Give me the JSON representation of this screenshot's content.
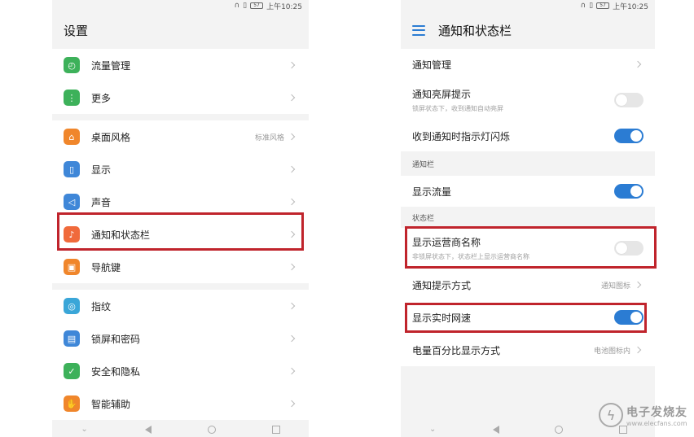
{
  "left": {
    "status": {
      "time": "上午10:25",
      "battery": "57"
    },
    "title": "设置",
    "items": [
      {
        "label": "流量管理",
        "icon": "data-usage-icon",
        "color": "#3db15a",
        "glyph": "◴"
      },
      {
        "label": "更多",
        "icon": "more-icon",
        "color": "#3db15a",
        "glyph": "⋮"
      },
      {
        "label": "桌面风格",
        "icon": "home-icon",
        "color": "#f0862b",
        "glyph": "⌂",
        "value": "标准风格"
      },
      {
        "label": "显示",
        "icon": "display-icon",
        "color": "#3f87d8",
        "glyph": "▯"
      },
      {
        "label": "声音",
        "icon": "sound-icon",
        "color": "#3f87d8",
        "glyph": "◁"
      },
      {
        "label": "通知和状态栏",
        "icon": "bell-icon",
        "color": "#f06a3b",
        "glyph": "♪"
      },
      {
        "label": "导航键",
        "icon": "nav-key-icon",
        "color": "#f0862b",
        "glyph": "▣"
      },
      {
        "label": "指纹",
        "icon": "fingerprint-icon",
        "color": "#3aa6d8",
        "glyph": "◎"
      },
      {
        "label": "锁屏和密码",
        "icon": "lock-icon",
        "color": "#3f87d8",
        "glyph": "▤"
      },
      {
        "label": "安全和隐私",
        "icon": "shield-icon",
        "color": "#3db15a",
        "glyph": "✓"
      },
      {
        "label": "智能辅助",
        "icon": "hand-icon",
        "color": "#f0862b",
        "glyph": "✋"
      }
    ]
  },
  "right": {
    "status": {
      "time": "上午10:25",
      "battery": "57"
    },
    "title": "通知和状态栏",
    "rows": {
      "notif_manage": "通知管理",
      "screen_on": {
        "label": "通知亮屏提示",
        "sub": "锁屏状态下，收到通知自动亮屏",
        "on": false
      },
      "led": {
        "label": "收到通知时指示灯闪烁",
        "on": true
      },
      "section_notif": "通知栏",
      "show_traffic": {
        "label": "显示流量",
        "on": true
      },
      "section_status": "状态栏",
      "carrier": {
        "label": "显示运营商名称",
        "sub": "非锁屏状态下，状态栏上显示运营商名称",
        "on": false
      },
      "notif_style": {
        "label": "通知提示方式",
        "value": "通知图标"
      },
      "net_speed": {
        "label": "显示实时网速",
        "on": true
      },
      "battery_pct": {
        "label": "电量百分比显示方式",
        "value": "电池图标内"
      }
    }
  },
  "watermark": {
    "cn": "电子发烧友",
    "en": "www.elecfans.com"
  },
  "colors": {
    "accent": "#2b7cd3",
    "highlight": "#c0242c"
  }
}
